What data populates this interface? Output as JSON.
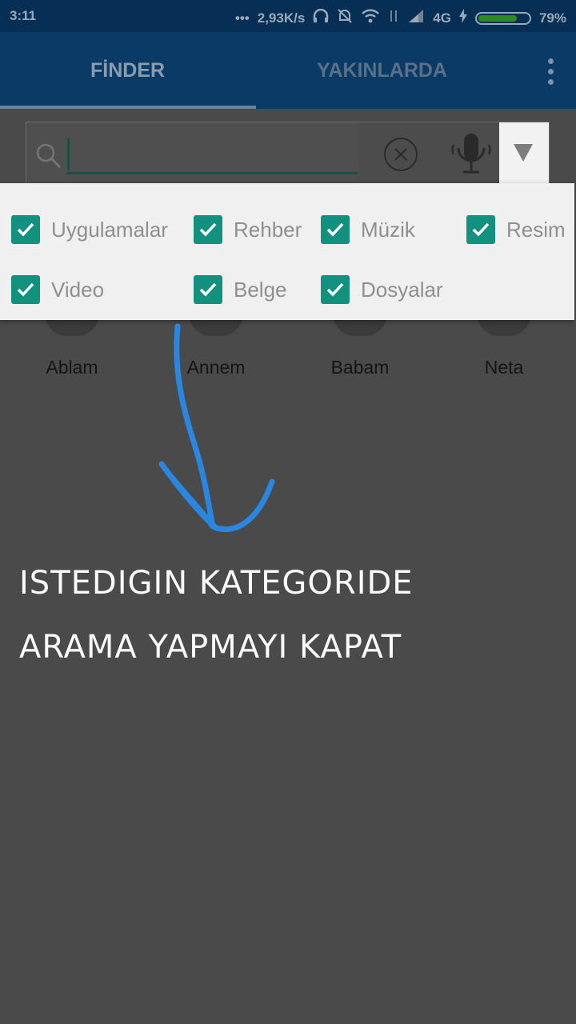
{
  "status_bar": {
    "time": "3:11",
    "speed": "2,93K/s",
    "network": "4G",
    "battery": "79%",
    "battery_level": 0.79
  },
  "app_bar": {
    "tabs": [
      {
        "label": "FİNDER",
        "selected": true
      },
      {
        "label": "YAKINLARDA",
        "selected": false
      }
    ]
  },
  "search": {
    "value": "",
    "placeholder": ""
  },
  "categories": [
    {
      "label": "Uygulamalar",
      "checked": true
    },
    {
      "label": "Rehber",
      "checked": true
    },
    {
      "label": "Müzik",
      "checked": true
    },
    {
      "label": "Resim",
      "checked": true
    },
    {
      "label": "Video",
      "checked": true
    },
    {
      "label": "Belge",
      "checked": true
    },
    {
      "label": "Dosyalar",
      "checked": true
    }
  ],
  "contacts": [
    {
      "name": "Ablam"
    },
    {
      "name": "Annem"
    },
    {
      "name": "Babam"
    },
    {
      "name": "Neta"
    }
  ],
  "annotation": {
    "line1": "ISTEDIGIN KATEGORIDE",
    "line2": "ARAMA YAPMAYI KAPAT",
    "arrow_color": "#2a86df"
  },
  "colors": {
    "accent": "#13917f",
    "status_bar": "#072f55",
    "app_bar": "#0a3a66",
    "overlay_bg": "#4a4a4a"
  }
}
